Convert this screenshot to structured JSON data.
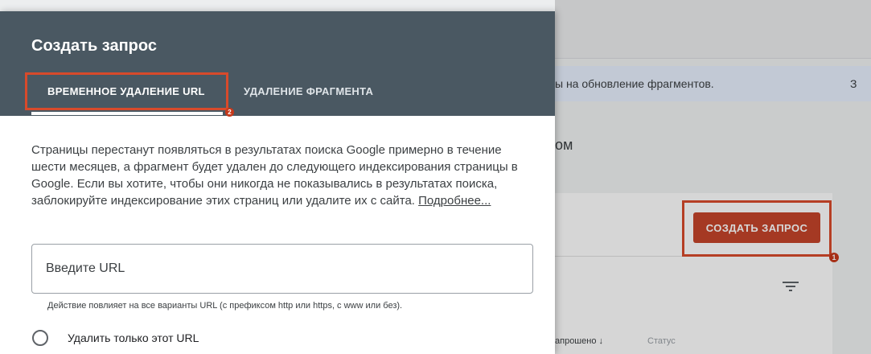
{
  "dialog": {
    "title": "Создать запрос",
    "tabs": [
      {
        "label": "ВРЕМЕННОЕ УДАЛЕНИЕ URL",
        "badge": "2"
      },
      {
        "label": "УДАЛЕНИЕ ФРАГМЕНТА"
      }
    ],
    "description": "Страницы перестанут появляться в результатах поиска Google примерно в течение шести месяцев, а фрагмент будет удален до следующего индексирования страницы в Google. Если вы хотите, чтобы они никогда не показывались в результатах поиска, заблокируйте индексирование этих страниц или удалите их с сайта.",
    "learn_more": "Подробнее...",
    "url_placeholder": "Введите URL",
    "helper_text": "Действие повлияет на все варианты URL (с префиксом http или https, с www или без).",
    "radio_option": "Удалить только этот URL"
  },
  "background": {
    "banner_text": "ы на обновление фрагментов.",
    "banner_trailing": "З",
    "section_text": "ом",
    "create_button": "СОЗДАТЬ ЗАПРОС",
    "create_badge": "1",
    "column_header": "апрошено ↓",
    "column_status": "Статус"
  },
  "colors": {
    "header": "#4a5862",
    "highlight": "#d84a2b",
    "create_button": "#c5442a"
  },
  "icons": [
    "filter-icon",
    "sort-arrow-icon",
    "radio-unchecked-icon"
  ]
}
